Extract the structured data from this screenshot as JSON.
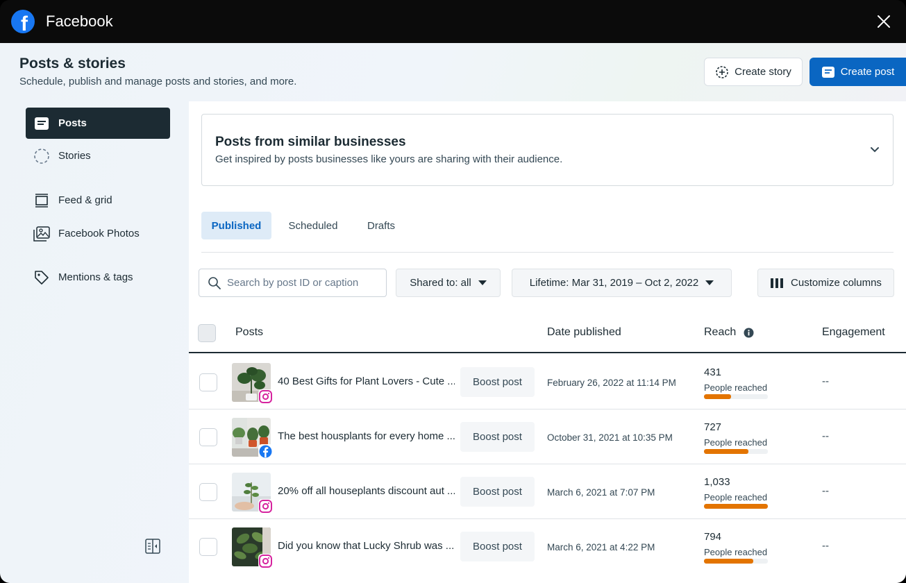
{
  "window": {
    "app_title": "Facebook"
  },
  "header": {
    "title": "Posts & stories",
    "subtitle": "Schedule, publish and manage posts and stories, and more.",
    "create_story_label": "Create story",
    "create_post_label": "Create post"
  },
  "sidebar": {
    "items": [
      {
        "label": "Posts",
        "icon": "posts-icon",
        "active": true
      },
      {
        "label": "Stories",
        "icon": "stories-icon",
        "active": false
      },
      {
        "label": "Feed & grid",
        "icon": "feed-grid-icon",
        "active": false
      },
      {
        "label": "Facebook Photos",
        "icon": "photos-icon",
        "active": false
      },
      {
        "label": "Mentions & tags",
        "icon": "tag-icon",
        "active": false
      }
    ]
  },
  "similar": {
    "title": "Posts from similar businesses",
    "subtitle": "Get inspired by posts businesses like yours are sharing with their audience."
  },
  "tabs": [
    {
      "label": "Published",
      "active": true
    },
    {
      "label": "Scheduled",
      "active": false
    },
    {
      "label": "Drafts",
      "active": false
    }
  ],
  "filters": {
    "search_placeholder": "Search by post ID or caption",
    "shared_to": "Shared to: all",
    "date_range": "Lifetime: Mar 31, 2019 – Oct 2, 2022",
    "customize_label": "Customize columns"
  },
  "table": {
    "headers": {
      "posts": "Posts",
      "date": "Date published",
      "reach": "Reach",
      "engagement": "Engagement"
    },
    "boost_label": "Boost post",
    "reach_label": "People reached",
    "rows": [
      {
        "caption": "40 Best Gifts for Plant Lovers - Cute ...",
        "platform": "instagram",
        "date": "February 26, 2022 at 11:14 PM",
        "reach": "431",
        "reach_fraction": 0.42,
        "engagement": "--"
      },
      {
        "caption": "The best housplants for every home ...",
        "platform": "facebook",
        "date": "October 31, 2021 at 10:35 PM",
        "reach": "727",
        "reach_fraction": 0.7,
        "engagement": "--"
      },
      {
        "caption": "20% off all houseplants discount aut ...",
        "platform": "instagram",
        "date": "March 6, 2021 at 7:07 PM",
        "reach": "1,033",
        "reach_fraction": 1.0,
        "engagement": "--"
      },
      {
        "caption": "Did you know that Lucky Shrub was ...",
        "platform": "instagram",
        "date": "March 6, 2021 at 4:22 PM",
        "reach": "794",
        "reach_fraction": 0.77,
        "engagement": "--"
      }
    ]
  },
  "colors": {
    "primary": "#0a66c2",
    "dark": "#1c2b33",
    "reach_bar": "#e37400",
    "facebook": "#1877f2"
  }
}
